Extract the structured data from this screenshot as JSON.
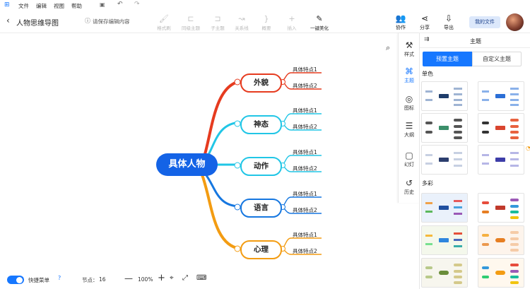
{
  "menubar": {
    "items": [
      "文件",
      "编辑",
      "视图",
      "帮助"
    ]
  },
  "titlebar": {
    "doc_title": "人物思维导图",
    "save_notice": "请保存编辑内容",
    "tools": [
      "格式刷",
      "同级主题",
      "子主题",
      "关系线",
      "概要",
      "插入",
      "一键美化"
    ],
    "right_tools": [
      "协作",
      "分享",
      "导出"
    ],
    "my_files": "我的文件"
  },
  "mindmap": {
    "root": "具体人物",
    "branches": [
      {
        "label": "外貌",
        "color": "#e63b1f",
        "leaves": [
          "具体特点1",
          "具体特点2"
        ]
      },
      {
        "label": "神态",
        "color": "#21c6e6",
        "leaves": [
          "具体特点1",
          "具体特点2"
        ]
      },
      {
        "label": "动作",
        "color": "#1fc7e6",
        "leaves": [
          "具体特点1",
          "具体特点2"
        ]
      },
      {
        "label": "语言",
        "color": "#1677e0",
        "leaves": [
          "具体特点1",
          "具体特点2"
        ]
      },
      {
        "label": "心理",
        "color": "#f39c12",
        "leaves": [
          "具体特点1",
          "具体特点2"
        ]
      }
    ]
  },
  "sidenav": {
    "items": [
      "样式",
      "主题",
      "图标",
      "大纲",
      "幻灯",
      "历史"
    ]
  },
  "themepanel": {
    "title": "主题",
    "tab_preset": "预置主题",
    "tab_custom": "自定义主题",
    "section_mono": "单色",
    "section_multi": "多彩"
  },
  "statusbar": {
    "quick_menu": "快捷菜单",
    "node_label": "节点：",
    "node_count": "16",
    "zoom": "100%"
  },
  "colors": {
    "primary": "#1677ff",
    "root_fill": "#1463e6"
  }
}
